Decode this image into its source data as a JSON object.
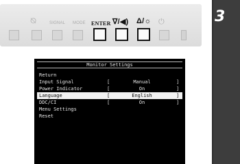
{
  "panel": {
    "labels": {
      "input_icon": "⦰",
      "signal": "SIGNAL",
      "mode": "MODE",
      "enter": "ENTER",
      "down_volume": "∇/◀)",
      "up_brightness": "Δ/☼",
      "power": "⏻"
    },
    "active_keys": [
      "enter",
      "down_volume",
      "up_brightness"
    ]
  },
  "step": {
    "number": "3"
  },
  "osd": {
    "title": "Monitor Settings",
    "items": [
      {
        "label": "Return"
      },
      {
        "label": "Input Signal",
        "value": "Manual"
      },
      {
        "label": "Power Indicator",
        "value": "On"
      },
      {
        "label": "Language",
        "value": "English",
        "selected": true
      },
      {
        "label": "DDC/CI",
        "value": "On"
      },
      {
        "label": "Menu Settings"
      },
      {
        "label": "Reset"
      }
    ],
    "bracket_open": "[",
    "bracket_close": "]"
  }
}
